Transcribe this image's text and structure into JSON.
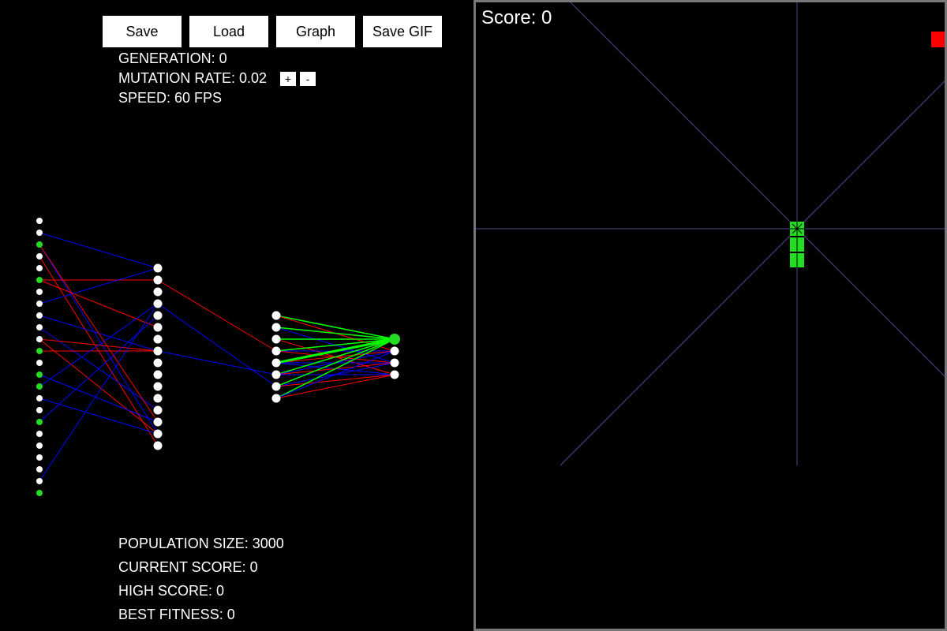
{
  "toolbar": {
    "save_label": "Save",
    "load_label": "Load",
    "graph_label": "Graph",
    "save_gif_label": "Save GIF"
  },
  "stats_top": {
    "generation": "GENERATION: 0",
    "mutation_rate": "MUTATION RATE: 0.02",
    "mutation_plus": "+",
    "mutation_minus": "-",
    "speed": "SPEED: 60 FPS"
  },
  "stats_bottom": {
    "population_size": "POPULATION SIZE: 3000",
    "current_score": "CURRENT SCORE: 0",
    "high_score": "HIGH SCORE: 0",
    "best_fitness": "BEST FITNESS: 0"
  },
  "game": {
    "score_label": "Score: 0",
    "snake_color": "#22dd22",
    "food_color": "#ff0000",
    "vision_line_color": "#4a4a8a",
    "border_color": "#777777"
  },
  "network": {
    "layer_sizes": [
      24,
      16,
      8,
      4
    ],
    "active_inputs": [
      2,
      5,
      11,
      13,
      14,
      17,
      23
    ],
    "active_outputs": [
      0
    ],
    "positive_color": "#ff0000",
    "negative_color": "#0000ff",
    "output_link_color": "#00ff00",
    "active_node_color": "#22dd22",
    "inactive_node_color": "#ffffff"
  }
}
